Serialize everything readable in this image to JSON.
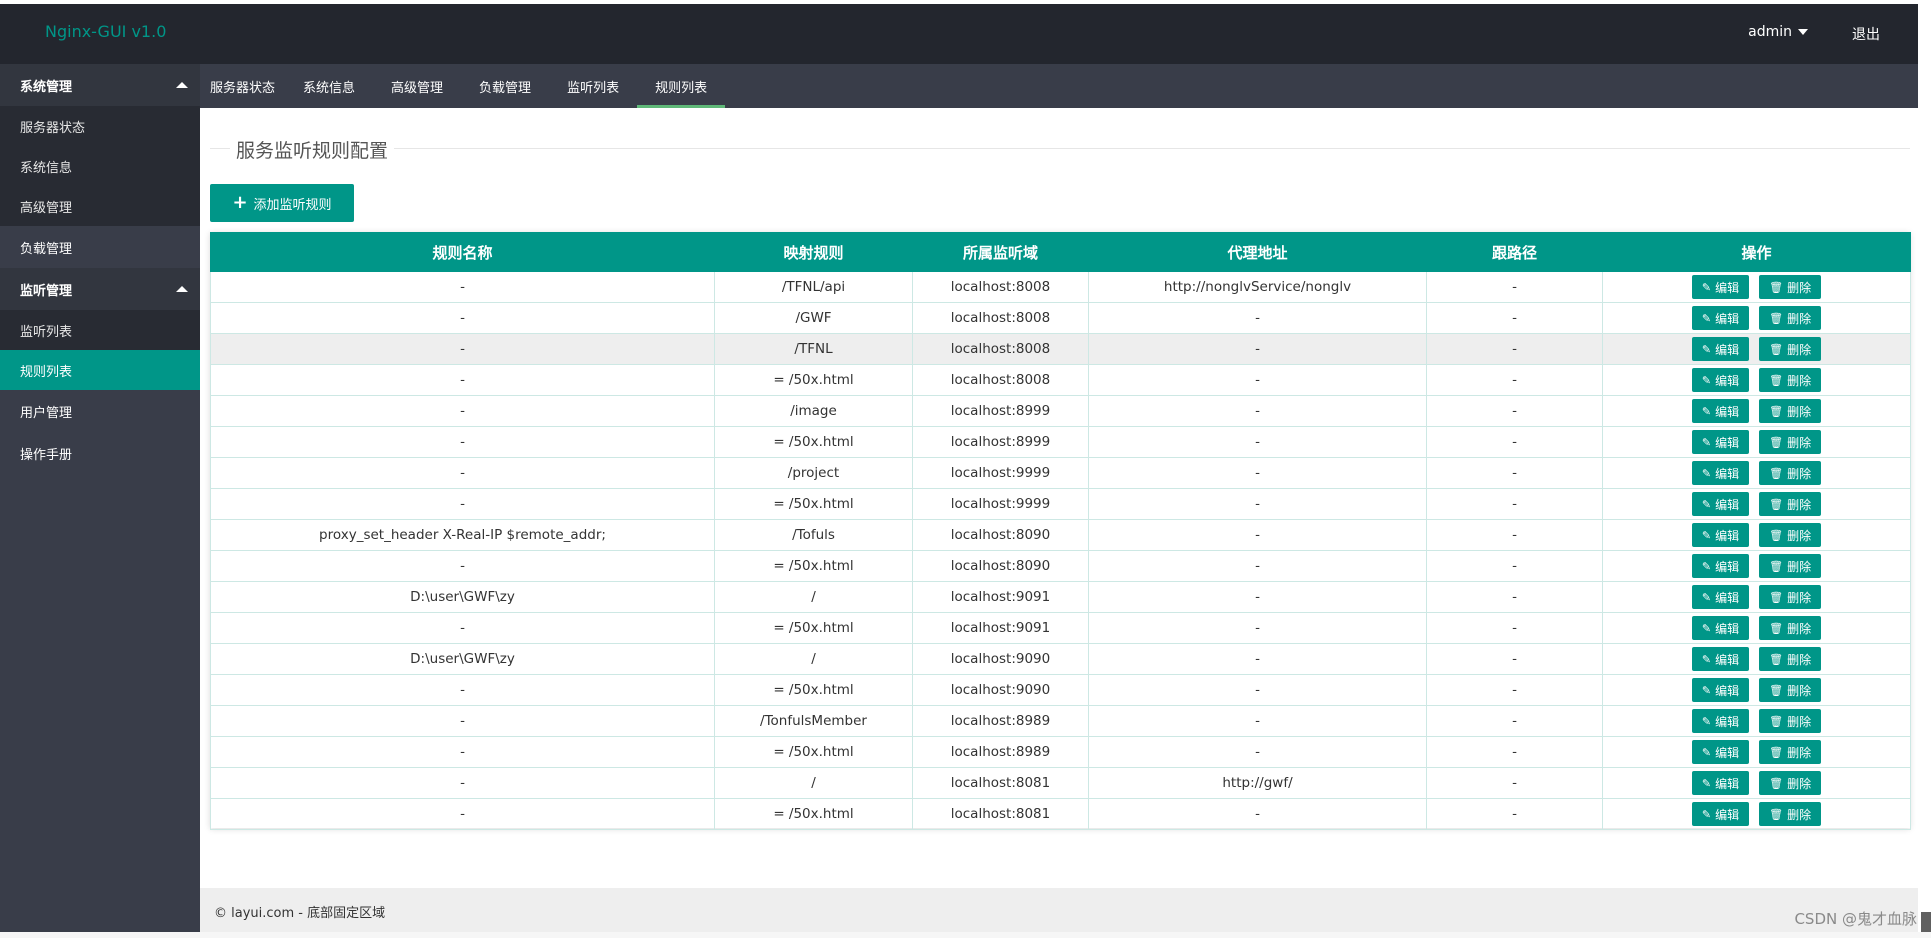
{
  "header": {
    "logo": "Nginx-GUI v1.0",
    "user": "admin",
    "logout": "退出"
  },
  "sidebar": {
    "groups": [
      {
        "label": "系统管理",
        "items": [
          "服务器状态",
          "系统信息",
          "高级管理"
        ]
      },
      {
        "label": "负载管理"
      },
      {
        "label": "监听管理",
        "items": [
          "监听列表",
          "规则列表"
        ],
        "active": "规则列表"
      },
      {
        "label": "用户管理"
      },
      {
        "label": "操作手册"
      }
    ]
  },
  "tabs": [
    "服务器状态",
    "系统信息",
    "高级管理",
    "负载管理",
    "监听列表",
    "规则列表"
  ],
  "active_tab": "规则列表",
  "page_title": "服务监听规则配置",
  "add_button": "添加监听规则",
  "table": {
    "headers": [
      "规则名称",
      "映射规则",
      "所属监听域",
      "代理地址",
      "跟路径",
      "操作"
    ],
    "edit_label": "编辑",
    "delete_label": "删除",
    "rows": [
      [
        "-",
        "/TFNL/api",
        "localhost:8008",
        "http://nonglvService/nonglv",
        "-"
      ],
      [
        "-",
        "/GWF",
        "localhost:8008",
        "-",
        "-"
      ],
      [
        "-",
        "/TFNL",
        "localhost:8008",
        "-",
        "-"
      ],
      [
        "-",
        "= /50x.html",
        "localhost:8008",
        "-",
        "-"
      ],
      [
        "-",
        "/image",
        "localhost:8999",
        "-",
        "-"
      ],
      [
        "-",
        "= /50x.html",
        "localhost:8999",
        "-",
        "-"
      ],
      [
        "-",
        "/project",
        "localhost:9999",
        "-",
        "-"
      ],
      [
        "-",
        "= /50x.html",
        "localhost:9999",
        "-",
        "-"
      ],
      [
        "proxy_set_header X-Real-IP $remote_addr;",
        "/Tofuls",
        "localhost:8090",
        "-",
        "-"
      ],
      [
        "-",
        "= /50x.html",
        "localhost:8090",
        "-",
        "-"
      ],
      [
        "D:\\user\\GWF\\zy",
        "/",
        "localhost:9091",
        "-",
        "-"
      ],
      [
        "-",
        "= /50x.html",
        "localhost:9091",
        "-",
        "-"
      ],
      [
        "D:\\user\\GWF\\zy",
        "/",
        "localhost:9090",
        "-",
        "-"
      ],
      [
        "-",
        "= /50x.html",
        "localhost:9090",
        "-",
        "-"
      ],
      [
        "-",
        "/TonfulsMember",
        "localhost:8989",
        "-",
        "-"
      ],
      [
        "-",
        "= /50x.html",
        "localhost:8989",
        "-",
        "-"
      ],
      [
        "-",
        "/",
        "localhost:8081",
        "http://gwf/",
        "-"
      ],
      [
        "-",
        "= /50x.html",
        "localhost:8081",
        "-",
        "-"
      ]
    ]
  },
  "footer": "© layui.com - 底部固定区域",
  "watermark": "CSDN @鬼才血脉",
  "colors": {
    "accent": "#009688",
    "header_bg": "#23262e",
    "sidebar_bg": "#393d49"
  }
}
